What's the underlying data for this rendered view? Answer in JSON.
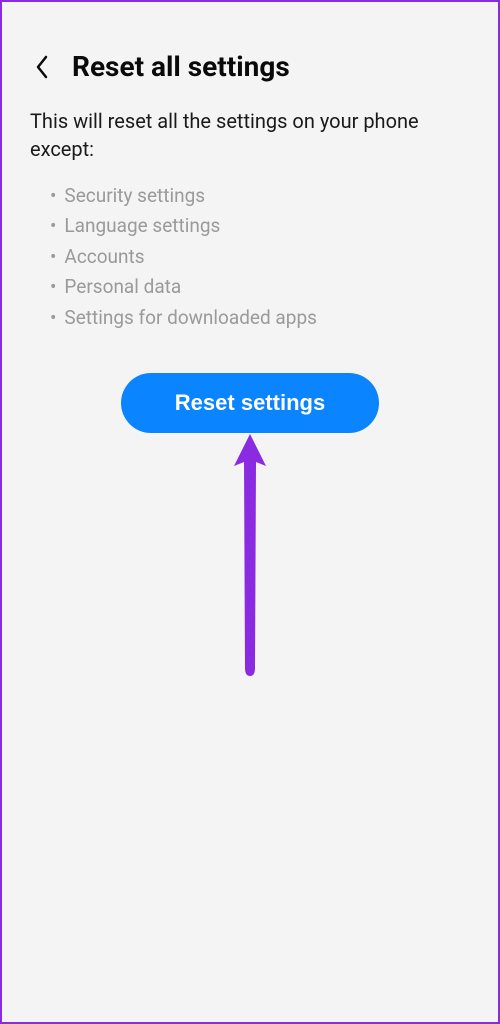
{
  "header": {
    "title": "Reset all settings"
  },
  "description": "This will reset all the settings on your phone except:",
  "bullets": [
    "Security settings",
    "Language settings",
    "Accounts",
    "Personal data",
    "Settings for downloaded apps"
  ],
  "button": {
    "label": "Reset settings"
  },
  "colors": {
    "accent": "#0a84ff",
    "annotation": "#8a2be2"
  }
}
